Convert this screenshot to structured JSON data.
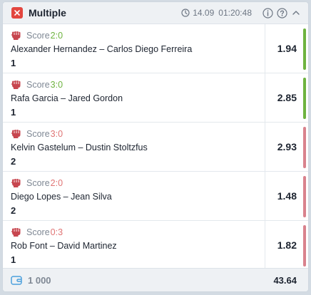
{
  "header": {
    "title": "Multiple",
    "date": "14.09",
    "time": "01:20:48"
  },
  "colors": {
    "win": "#6eb33f",
    "loss": "#d9828d",
    "score_win": "#6eb33f",
    "score_loss": "#e07474",
    "close_bg": "#e3463f",
    "sport_icon": "#c7464f"
  },
  "bets": [
    {
      "score_label": "Score",
      "score": "2:0",
      "teams": "Alexander Hernandez – Carlos Diego Ferreira",
      "pick": "1",
      "odds": "1.94",
      "result": "win",
      "icon": "fist-icon"
    },
    {
      "score_label": "Score",
      "score": "3:0",
      "teams": "Rafa Garcia – Jared Gordon",
      "pick": "1",
      "odds": "2.85",
      "result": "win",
      "icon": "fist-icon"
    },
    {
      "score_label": "Score",
      "score": "3:0",
      "teams": "Kelvin Gastelum – Dustin Stoltzfus",
      "pick": "2",
      "odds": "2.93",
      "result": "loss",
      "icon": "fist-icon"
    },
    {
      "score_label": "Score",
      "score": "2:0",
      "teams": "Diego Lopes – Jean Silva",
      "pick": "2",
      "odds": "1.48",
      "result": "loss",
      "icon": "fist-icon"
    },
    {
      "score_label": "Score",
      "score": "0:3",
      "teams": "Rob Font – David Martinez",
      "pick": "1",
      "odds": "1.82",
      "result": "loss",
      "icon": "fist-icon"
    }
  ],
  "footer": {
    "stake": "1 000",
    "total_odds": "43.64"
  }
}
